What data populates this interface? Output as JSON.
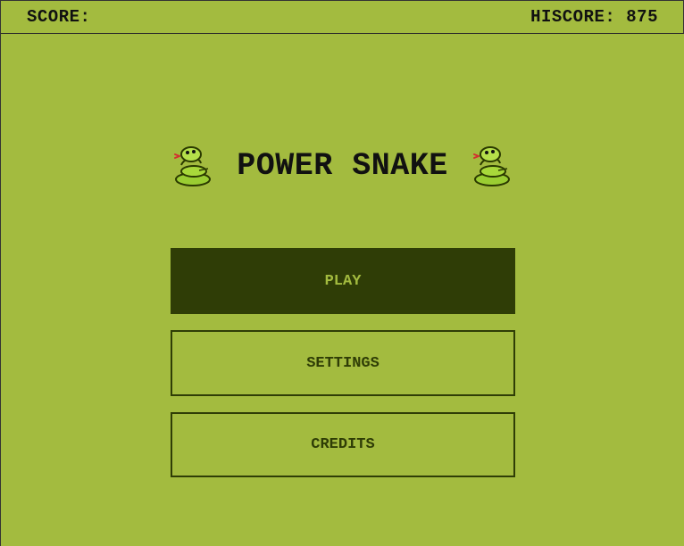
{
  "topbar": {
    "score_label": "SCORE:",
    "score_value": "",
    "hiscore_label": "HISCORE:",
    "hiscore_value": "875"
  },
  "title": {
    "text": "POWER SNAKE",
    "icon_left": "snake-icon",
    "icon_right": "snake-icon"
  },
  "menu": {
    "play_label": "PLAY",
    "settings_label": "SETTINGS",
    "credits_label": "CREDITS"
  },
  "colors": {
    "background": "#a3bb3f",
    "dark_green": "#2f3d06",
    "text": "#111111"
  }
}
